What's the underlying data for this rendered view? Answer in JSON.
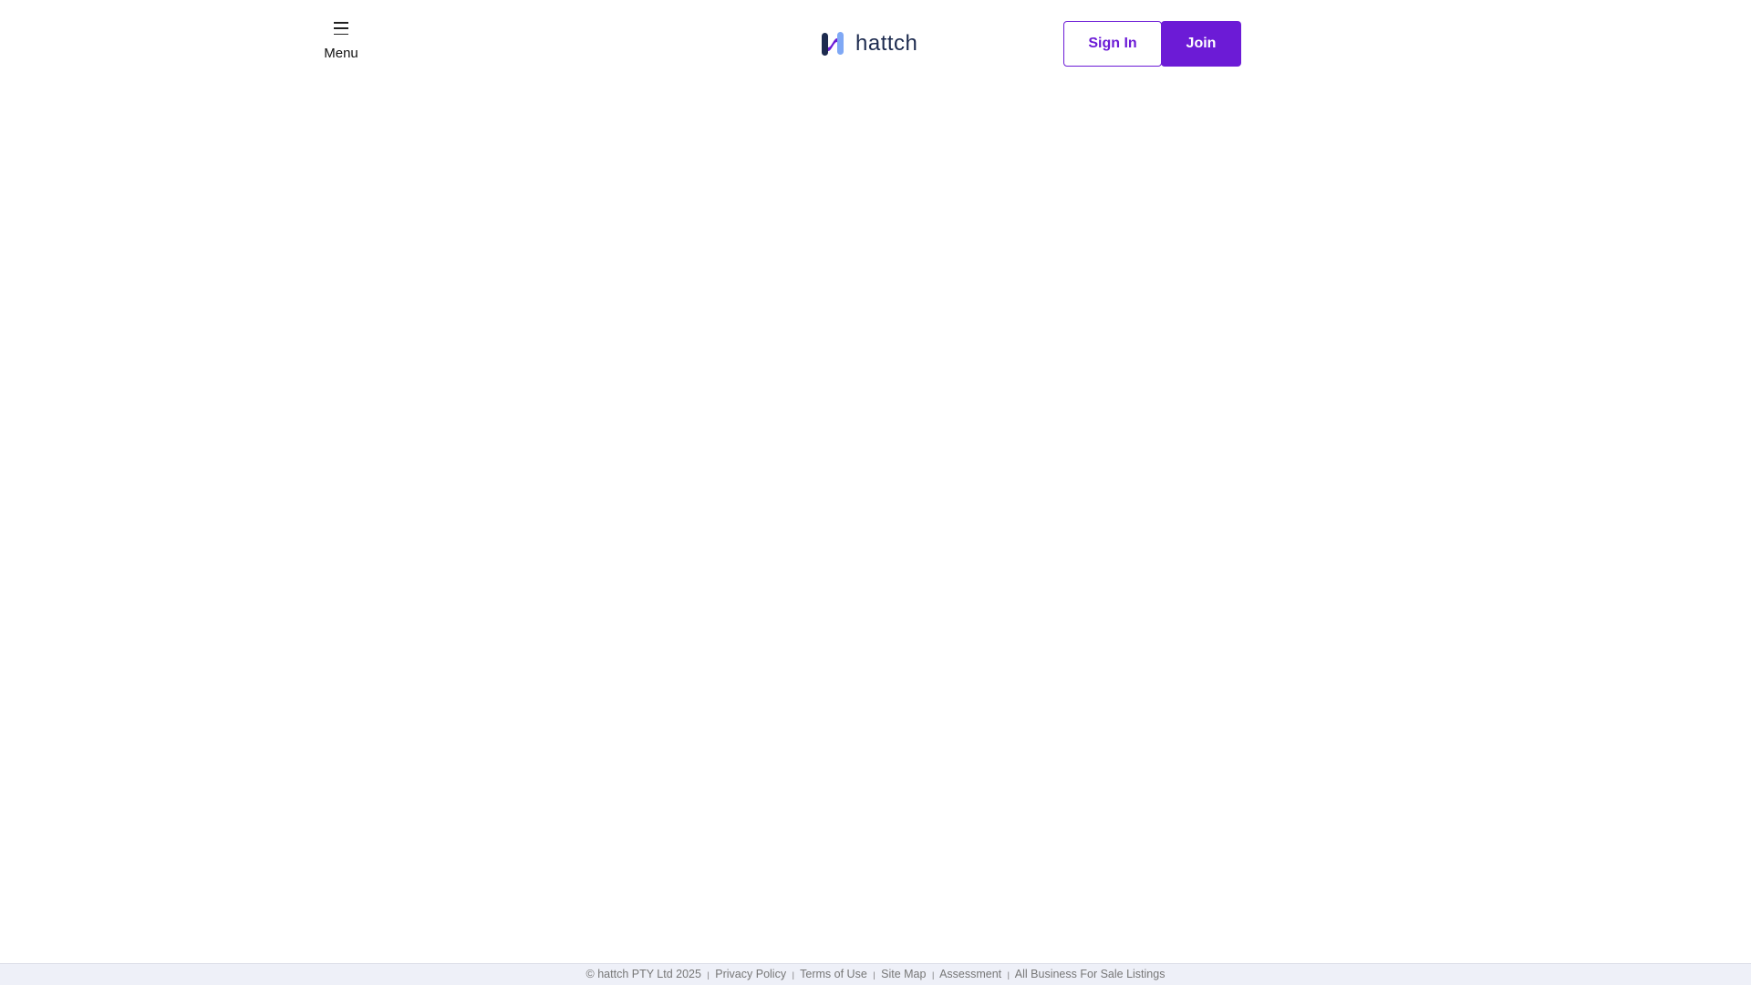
{
  "header": {
    "menu_label": "Menu",
    "logo_text": "hattch",
    "sign_in": "Sign In",
    "join": "Join"
  },
  "colors": {
    "accent": "#6c1bd6",
    "logo_dark": "#1d2b4f",
    "footer_bg": "#eef0f8"
  },
  "footer": {
    "copyright": "© hattch PTY Ltd 2025",
    "separator": "|",
    "links": [
      "Privacy Policy",
      "Terms of Use",
      "Site Map",
      "Assessment",
      "All Business For Sale Listings"
    ]
  }
}
